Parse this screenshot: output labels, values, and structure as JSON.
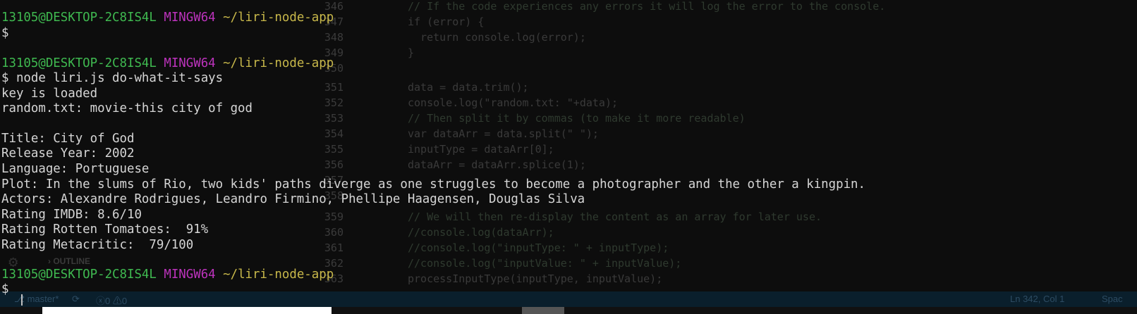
{
  "editor": {
    "gutter": [
      "346",
      "347",
      "348",
      "349",
      "350",
      "351",
      "352",
      "353",
      "354",
      "355",
      "356",
      "357",
      "358",
      "359",
      "360",
      "361",
      "362",
      "363"
    ],
    "code": [
      {
        "text": "// If the code experiences any errors it will log the error to the console.",
        "kind": "cm"
      },
      {
        "text": "if (error) {",
        "kind": ""
      },
      {
        "text": "  return console.log(error);",
        "kind": ""
      },
      {
        "text": "}",
        "kind": ""
      },
      {
        "text": "",
        "kind": ""
      },
      {
        "text": "data = data.trim();",
        "kind": ""
      },
      {
        "text": "console.log(\"random.txt: \"+data);",
        "kind": ""
      },
      {
        "text": "// Then split it by commas (to make it more readable)",
        "kind": "cm"
      },
      {
        "text": "var dataArr = data.split(\" \");",
        "kind": ""
      },
      {
        "text": "inputType = dataArr[0];",
        "kind": ""
      },
      {
        "text": "dataArr = dataArr.splice(1);",
        "kind": ""
      },
      {
        "text": "",
        "kind": ""
      },
      {
        "text": "",
        "kind": ""
      },
      {
        "text": "// We will then re-display the content as an array for later use.",
        "kind": "cm"
      },
      {
        "text": "//console.log(dataArr);",
        "kind": "cm"
      },
      {
        "text": "//console.log(\"inputType: \" + inputType);",
        "kind": "cm"
      },
      {
        "text": "//console.log(\"inputValue: \" + inputValue);",
        "kind": "cm"
      },
      {
        "text": "processInputType(inputType, inputValue);",
        "kind": ""
      }
    ],
    "outline_label": "OUTLINE"
  },
  "statusbar": {
    "branch": "master*",
    "sync_icon": "sync-icon",
    "errors": "0",
    "warnings": "0",
    "cursor_pos": "Ln 342, Col 1",
    "spaces": "Spac"
  },
  "terminal": {
    "user_host": "13105@DESKTOP-2C8IS4L",
    "shell": "MINGW64",
    "path": "~/liri-node-app",
    "dollar": "$",
    "command": "$ node liri.js do-what-it-says",
    "output": [
      "key is loaded",
      "random.txt: movie-this city of god",
      "",
      "Title: City of God",
      "Release Year: 2002",
      "Language: Portuguese",
      "Plot: In the slums of Rio, two kids' paths diverge as one struggles to become a photographer and the other a kingpin.",
      "Actors: Alexandre Rodrigues, Leandro Firmino, Phellipe Haagensen, Douglas Silva",
      "Rating IMDB: 8.6/10",
      "Rating Rotten Tomatoes:  91%",
      "Rating Metacritic:  79/100"
    ]
  }
}
